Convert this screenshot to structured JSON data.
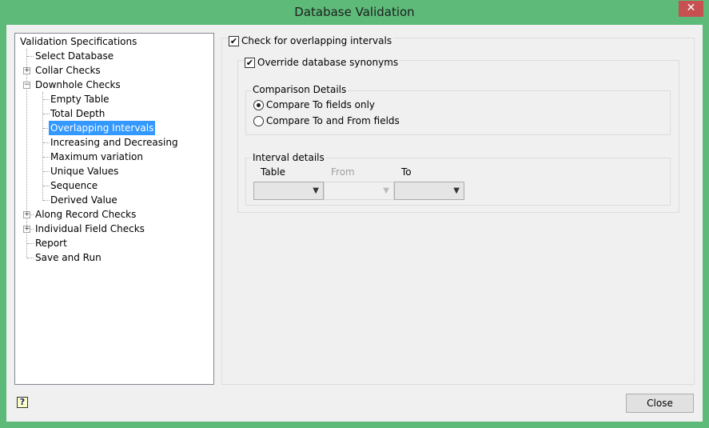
{
  "window": {
    "title": "Database Validation",
    "close_glyph": "✕"
  },
  "tree": {
    "root": "Validation Specifications",
    "items": [
      {
        "label": "Select Database"
      },
      {
        "label": "Collar Checks"
      },
      {
        "label": "Downhole Checks"
      },
      {
        "label": "Empty Table"
      },
      {
        "label": "Total Depth"
      },
      {
        "label": "Overlapping Intervals"
      },
      {
        "label": "Increasing and Decreasing"
      },
      {
        "label": "Maximum variation"
      },
      {
        "label": "Unique Values"
      },
      {
        "label": "Sequence"
      },
      {
        "label": "Derived Value"
      },
      {
        "label": "Along Record Checks"
      },
      {
        "label": "Individual Field Checks"
      },
      {
        "label": "Report"
      },
      {
        "label": "Save and Run"
      }
    ]
  },
  "panel": {
    "check_overlap": "Check for overlapping intervals",
    "override": "Override database synonyms",
    "comparison": {
      "title": "Comparison Details",
      "opt1": "Compare To fields only",
      "opt2": "Compare To and From fields"
    },
    "interval": {
      "title": "Interval details",
      "table": "Table",
      "from": "From",
      "to": "To"
    }
  },
  "footer": {
    "close": "Close",
    "help_glyph": "?"
  }
}
